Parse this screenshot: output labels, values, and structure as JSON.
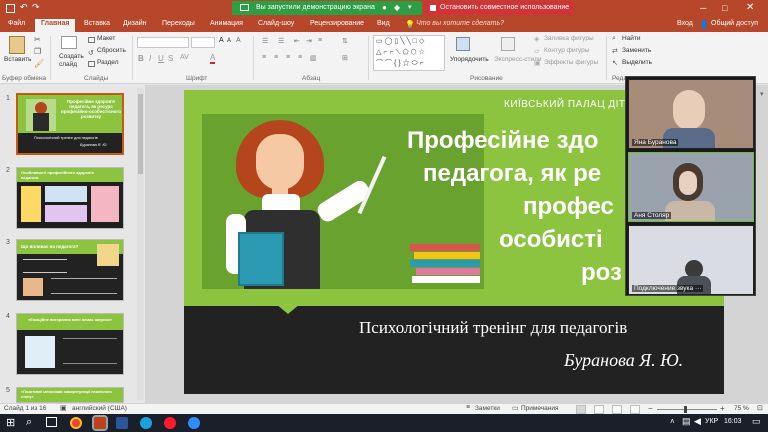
{
  "titlebar": {
    "screenshare_notice": "Вы запустили демонстрацию экрана",
    "stop_share": "Остановить совместное использование",
    "login": "Вход",
    "share": "Общий доступ"
  },
  "tabs": [
    "Файл",
    "Главная",
    "Вставка",
    "Дизайн",
    "Переходы",
    "Анимация",
    "Слайд-шоу",
    "Рецензирование",
    "Вид"
  ],
  "tell_me": "Что вы хотите сделать?",
  "ribbon": {
    "paste": "Вставить",
    "create_slide": "Создать слайд",
    "layout": "Макет",
    "reset": "Сбросить",
    "section": "Раздел",
    "arrange": "Упорядочить",
    "quick_styles": "Экспресс-стили",
    "shape_fill": "Заливка фигуры",
    "shape_outline": "Контур фигуры",
    "shape_effects": "Эффекты фигуры",
    "find": "Найти",
    "replace": "Заменить",
    "select": "Выделить",
    "groups": {
      "clipboard": "Буфер обмена",
      "slides": "Слайды",
      "font": "Шрифт",
      "paragraph": "Абзац",
      "drawing": "Рисование",
      "editing": "Реда"
    }
  },
  "thumbnails": {
    "numbers": [
      "1",
      "2",
      "3",
      "4",
      "5"
    ],
    "t1_title": "Професійне здоров'я педагога, як ресурс професійно-особистісного розвитку",
    "t1_sub": "Психологічний тренінг для педагогів",
    "t1_author": "Буранова Я. Ю.",
    "t2_title": "Особливості професійного здоров'я педагога",
    "t3_title": "Що впливає на педагога?",
    "t4_title": "«Емоційне вигорання мені немає загрози»",
    "t5_title": "«Позитивні механізми саморегуляції психічного стану»"
  },
  "slide": {
    "org": "КИЇВСЬКИЙ ПАЛАЦ ДІТЕ",
    "title_lines": [
      "Професійне здо",
      "педагога, як ре",
      "профес",
      "особисті",
      "роз"
    ],
    "subtitle": "Психологічний тренінг для педагогів",
    "author": "Буранова  Я. Ю."
  },
  "participants": [
    {
      "name": "Яна Буранова"
    },
    {
      "name": "Аня Столяр"
    },
    {
      "name": "Подключение звука ···"
    }
  ],
  "status": {
    "slide_of": "Слайд 1 из 16",
    "language": "английский (США)",
    "notes": "Заметки",
    "comments": "Примечания",
    "zoom": "75 %"
  },
  "taskbar": {
    "lang": "УКР",
    "time": "16:03"
  },
  "colors": {
    "accent": "#b7472a",
    "slide_green": "#8cc43f",
    "slide_dark": "#222222",
    "share_green": "#2e9e44",
    "stop_red": "#d13438"
  }
}
